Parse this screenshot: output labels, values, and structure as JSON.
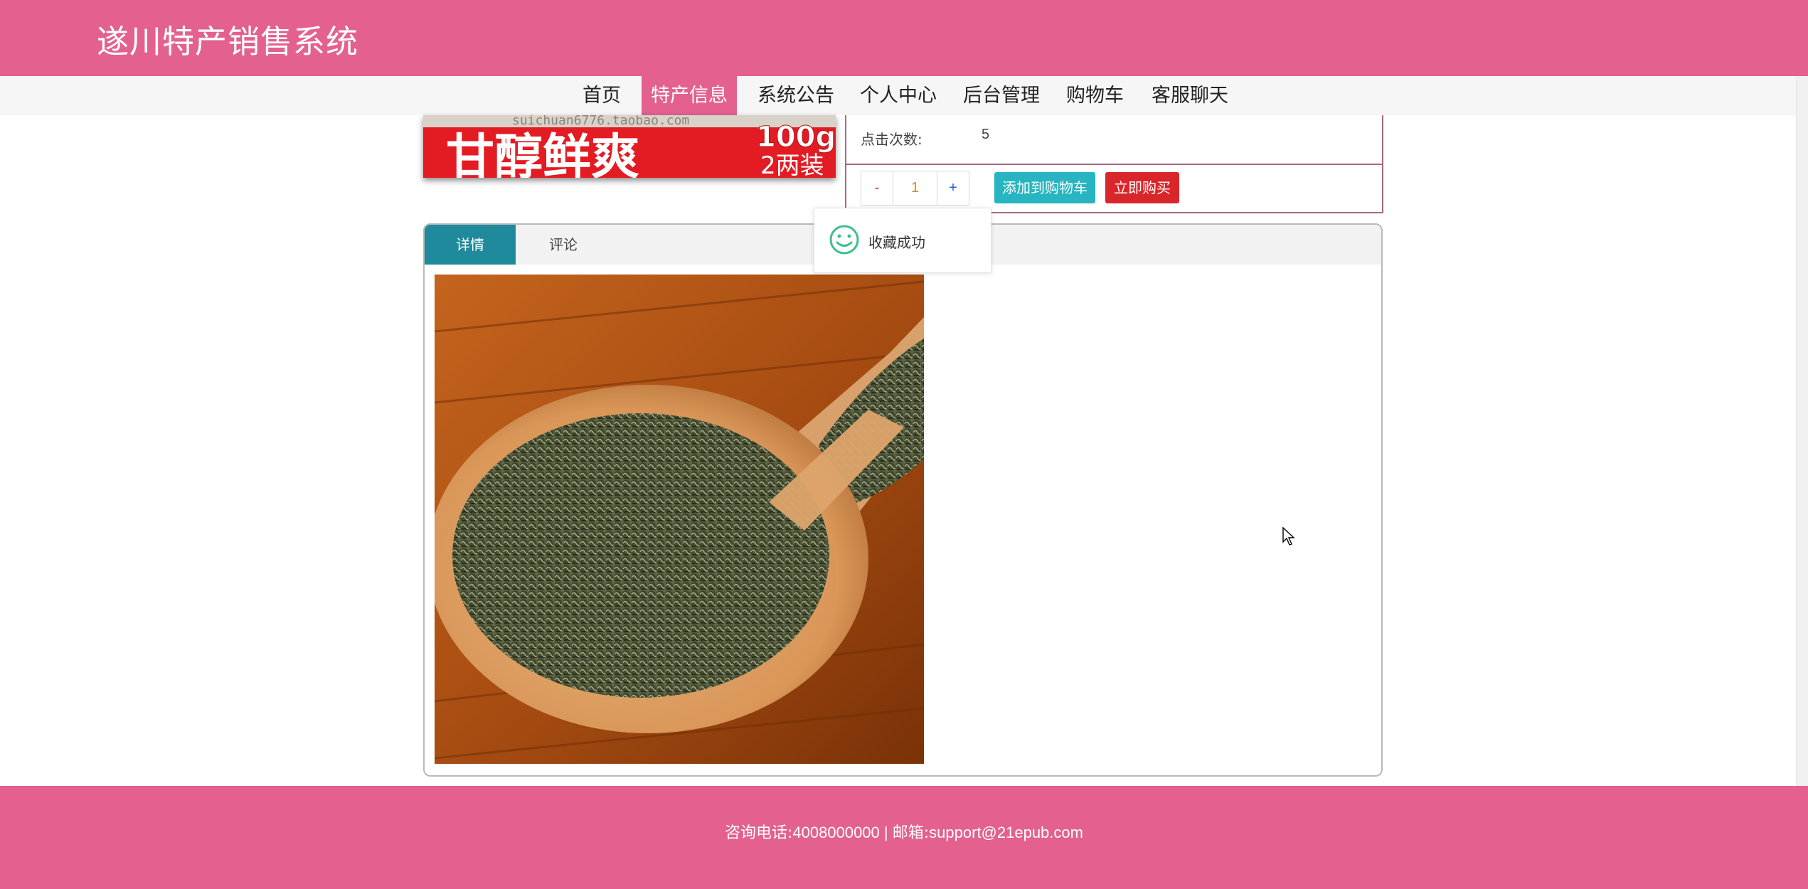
{
  "header": {
    "title": "遂川特产销售系统"
  },
  "nav": {
    "items": [
      {
        "label": "首页"
      },
      {
        "label": "特产信息",
        "active": true
      },
      {
        "label": "系统公告"
      },
      {
        "label": "个人中心"
      },
      {
        "label": "后台管理"
      },
      {
        "label": "购物车"
      },
      {
        "label": "客服聊天"
      }
    ]
  },
  "product": {
    "banner_text": "甘醇鲜爽",
    "banner_weight": "100g",
    "banner_pack": "2两装",
    "banner_watermark": "suichuan6776.taobao.com",
    "clicks_label": "点击次数:",
    "clicks_value": "5",
    "quantity": "1",
    "minus_label": "-",
    "plus_label": "+",
    "add_cart_label": "添加到购物车",
    "buy_now_label": "立即购买"
  },
  "toast": {
    "message": "收藏成功"
  },
  "tabs": {
    "detail_label": "详情",
    "comment_label": "评论"
  },
  "footer": {
    "phone_label": "咨询电话:",
    "phone": "4008000000",
    "separator": "|",
    "email_label": "邮箱:",
    "email": "support@21epub.com"
  },
  "colors": {
    "brand_pink": "#e3608f",
    "tab_active": "#1f8a9b",
    "cart_button": "#26b5c1",
    "buy_button": "#d9262b",
    "panel_border": "#a76a7d"
  }
}
